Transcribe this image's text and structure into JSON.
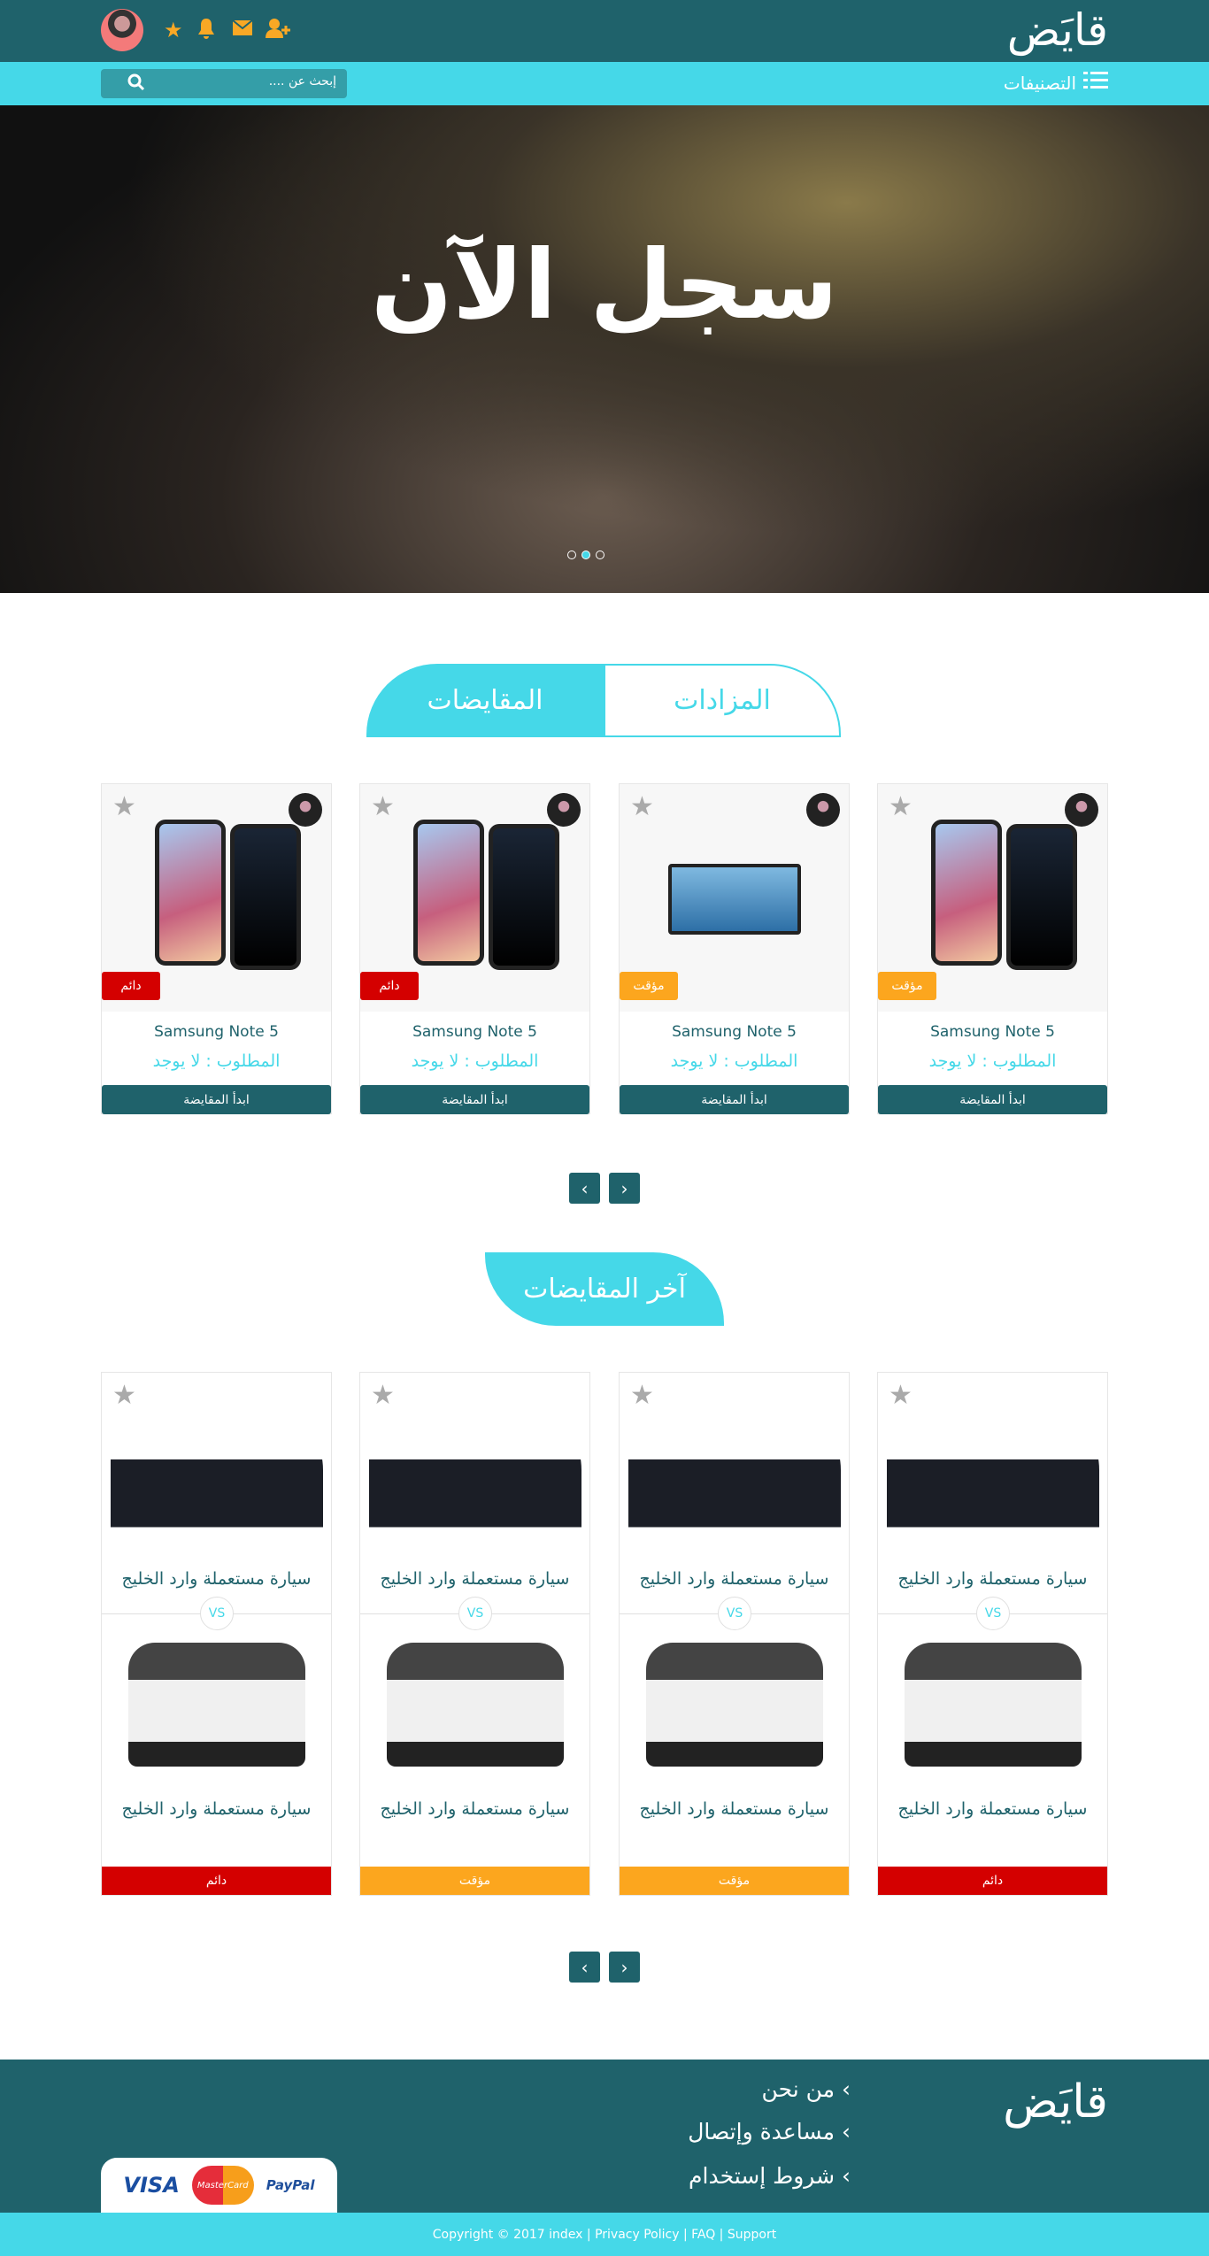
{
  "header": {
    "logo": "قايَض",
    "icons": [
      "user-plus-icon",
      "envelope-icon",
      "bell-icon",
      "star-icon"
    ]
  },
  "nav": {
    "categories": "التصنيفات",
    "search_placeholder": "إبحث عن ....",
    "search_value": ""
  },
  "hero": {
    "title": "سجل الآن",
    "active_slide": 2,
    "slides": 3
  },
  "tabs": [
    {
      "label": "المقايضات",
      "active": true
    },
    {
      "label": "المزادات",
      "active": false
    }
  ],
  "products": [
    {
      "title": "Samsung Note 5",
      "requirement": "المطلوب : لا يوجد",
      "badge": "دائم",
      "badge_color": "#d40000",
      "image": "phone",
      "button": "ابدأ المقايضة"
    },
    {
      "title": "Samsung Note 5",
      "requirement": "المطلوب : لا يوجد",
      "badge": "دائم",
      "badge_color": "#d40000",
      "image": "phone",
      "button": "ابدأ المقايضة"
    },
    {
      "title": "Samsung Note 5",
      "requirement": "المطلوب : لا يوجد",
      "badge": "مؤقت",
      "badge_color": "#fca61e",
      "image": "tv",
      "button": "ابدأ المقايضة"
    },
    {
      "title": "Samsung Note 5",
      "requirement": "المطلوب : لا يوجد",
      "badge": "مؤقت",
      "badge_color": "#fca61e",
      "image": "phone",
      "button": "ابدأ المقايضة"
    }
  ],
  "latest": {
    "title": "آخر المقايضات",
    "vs": "VS",
    "items": [
      {
        "top": "سيارة مستعملة وارد الخليج",
        "bottom": "سيارة مستعملة وارد الخليج",
        "status": "دائم",
        "color": "#d40000"
      },
      {
        "top": "سيارة مستعملة وارد الخليج",
        "bottom": "سيارة مستعملة وارد الخليج",
        "status": "مؤقت",
        "color": "#fca61e"
      },
      {
        "top": "سيارة مستعملة وارد الخليج",
        "bottom": "سيارة مستعملة وارد الخليج",
        "status": "مؤقت",
        "color": "#fca61e"
      },
      {
        "top": "سيارة مستعملة وارد الخليج",
        "bottom": "سيارة مستعملة وارد الخليج",
        "status": "دائم",
        "color": "#d40000"
      }
    ]
  },
  "footer": {
    "logo": "قايَض",
    "links": [
      "من نحن",
      "مساعدة وإتصال",
      "شروط إستخدام"
    ],
    "payments": [
      "VISA",
      "MasterCard",
      "PayPal"
    ],
    "copyright": "Copyright © 2017 index | Privacy Policy | FAQ | Support"
  },
  "colors": {
    "primary": "#1f626b",
    "accent": "#45d8e8",
    "icon": "#f9a825"
  }
}
